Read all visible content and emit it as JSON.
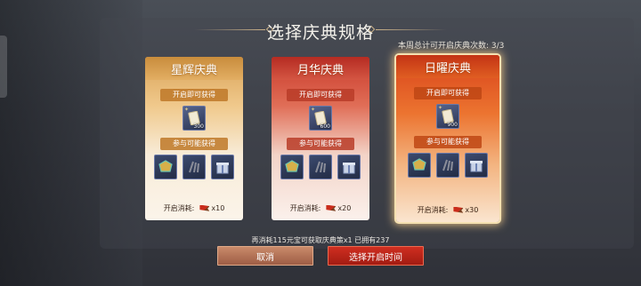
{
  "title": "选择庆典规格",
  "weekly_count": "本周总计可开启庆典次数: 3/3",
  "section_labels": {
    "open_reward": "开启即可获得",
    "join_reward": "参与可能获得",
    "cost": "开启消耗:"
  },
  "cards": [
    {
      "name": "星辉庆典",
      "open_item_qty": "300",
      "cost": "x10",
      "selected": false
    },
    {
      "name": "月华庆典",
      "open_item_qty": "600",
      "cost": "x20",
      "selected": false
    },
    {
      "name": "日曜庆典",
      "open_item_qty": "900",
      "cost": "x30",
      "selected": true
    }
  ],
  "join_items": [
    "gold-frame-icon",
    "dark-claw-icon",
    "gift-box-icon"
  ],
  "notice": "再消耗115元宝可获取庆典策x1 已拥有237",
  "buttons": {
    "cancel": "取消",
    "confirm": "选择开启时间"
  },
  "colors": {
    "gold": "#cdb48a",
    "confirm_red": "#cf2e20"
  }
}
